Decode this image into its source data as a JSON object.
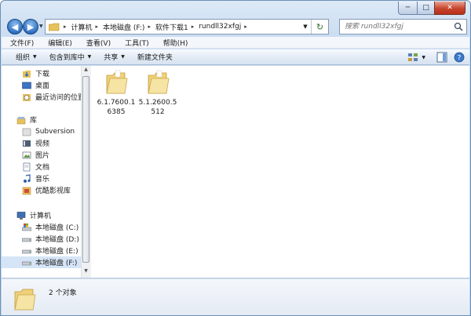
{
  "window": {
    "caption": {
      "minimize": "─",
      "maximize": "□",
      "close": "✕"
    }
  },
  "nav": {
    "back_icon": "back-arrow-icon",
    "forward_icon": "forward-arrow-icon",
    "address": {
      "breadcrumbs": [
        "计算机",
        "本地磁盘 (F:)",
        "软件下载1",
        "rundll32xfgj"
      ],
      "separator": "▸"
    },
    "search": {
      "placeholder": "搜索 rundll32xfgj"
    }
  },
  "menu": {
    "items": [
      "文件(F)",
      "编辑(E)",
      "查看(V)",
      "工具(T)",
      "帮助(H)"
    ]
  },
  "toolbar": {
    "items": [
      {
        "label": "组织",
        "arrow": "▼"
      },
      {
        "label": "包含到库中",
        "arrow": "▼"
      },
      {
        "label": "共享",
        "arrow": "▼"
      },
      {
        "label": "新建文件夹",
        "arrow": ""
      }
    ]
  },
  "sidebar": {
    "items": [
      {
        "label": "下载",
        "icon": "download-folder-icon"
      },
      {
        "label": "桌面",
        "icon": "desktop-icon"
      },
      {
        "label": "最近访问的位置",
        "icon": "recent-places-icon"
      },
      {
        "label": "库",
        "icon": "library-icon"
      },
      {
        "label": "Subversion",
        "icon": "subversion-icon"
      },
      {
        "label": "视频",
        "icon": "video-icon"
      },
      {
        "label": "图片",
        "icon": "picture-icon"
      },
      {
        "label": "文档",
        "icon": "document-icon"
      },
      {
        "label": "音乐",
        "icon": "music-icon"
      },
      {
        "label": "优酷影视库",
        "icon": "youku-library-icon"
      },
      {
        "label": "计算机",
        "icon": "computer-icon"
      },
      {
        "label": "本地磁盘 (C:)",
        "icon": "system-drive-icon"
      },
      {
        "label": "本地磁盘 (D:)",
        "icon": "drive-icon"
      },
      {
        "label": "本地磁盘 (E:)",
        "icon": "drive-icon"
      },
      {
        "label": "本地磁盘 (F:)",
        "icon": "drive-icon"
      }
    ],
    "selected": "本地磁盘 (F:)"
  },
  "files": [
    {
      "name": "6.1.7600.16385",
      "type": "folder"
    },
    {
      "name": "5.1.2600.5512",
      "type": "folder"
    }
  ],
  "details": {
    "count_text": "2 个对象"
  },
  "colors": {
    "titlebar": "#c9dcf0",
    "selection": "#d5e5f7",
    "folder": "#f0d078",
    "close_button": "#c7452c"
  }
}
